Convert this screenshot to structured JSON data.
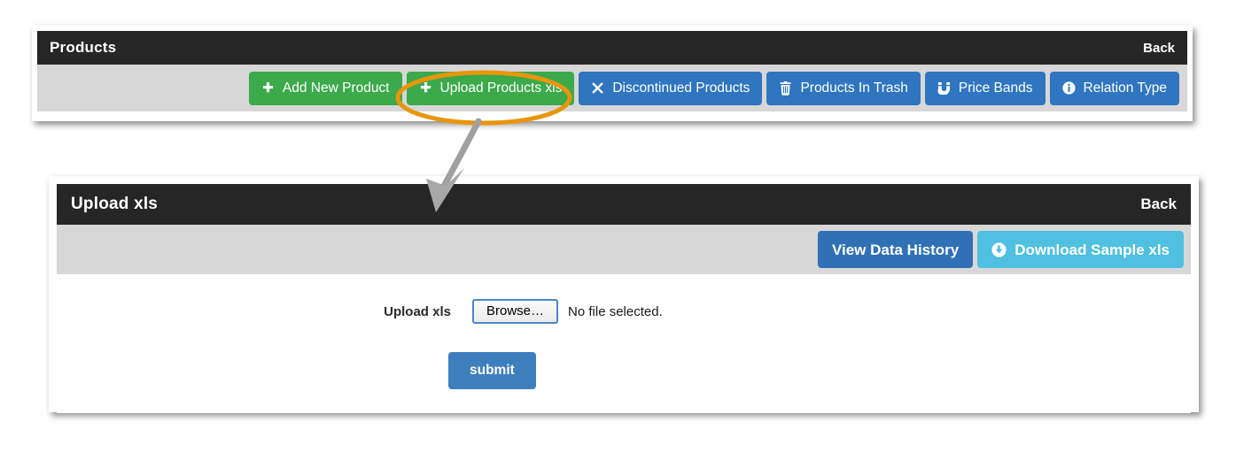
{
  "products_panel": {
    "title": "Products",
    "back_label": "Back",
    "buttons": [
      {
        "label": "Add New Product",
        "icon": "plus-icon",
        "style": "green"
      },
      {
        "label": "Upload Products xls",
        "icon": "plus-icon",
        "style": "green"
      },
      {
        "label": "Discontinued Products",
        "icon": "times-icon",
        "style": "blue"
      },
      {
        "label": "Products In Trash",
        "icon": "trash-icon",
        "style": "blue"
      },
      {
        "label": "Price Bands",
        "icon": "magnet-icon",
        "style": "blue"
      },
      {
        "label": "Relation Type",
        "icon": "info-icon",
        "style": "blue"
      }
    ]
  },
  "upload_panel": {
    "title": "Upload xls",
    "back_label": "Back",
    "toolbar_buttons": [
      {
        "label": "View Data History",
        "icon": "none",
        "style": "dkblue"
      },
      {
        "label": "Download Sample xls",
        "icon": "download-circle-icon",
        "style": "cyan"
      }
    ],
    "form": {
      "upload_label": "Upload xls",
      "browse_label": "Browse…",
      "file_status": "No file selected.",
      "submit_label": "submit"
    }
  },
  "annotation": {
    "highlight_target": "Upload Products xls",
    "highlight_color": "#e8960c",
    "arrow_color": "#a0a0a0"
  },
  "colors": {
    "header_bar": "#262626",
    "toolbar_bg": "#d7d7d7",
    "green": "#3ca94b",
    "blue": "#2f75bf",
    "dark_blue": "#3071b5",
    "cyan": "#4fc0e0",
    "submit_blue": "#3d7ebd"
  }
}
